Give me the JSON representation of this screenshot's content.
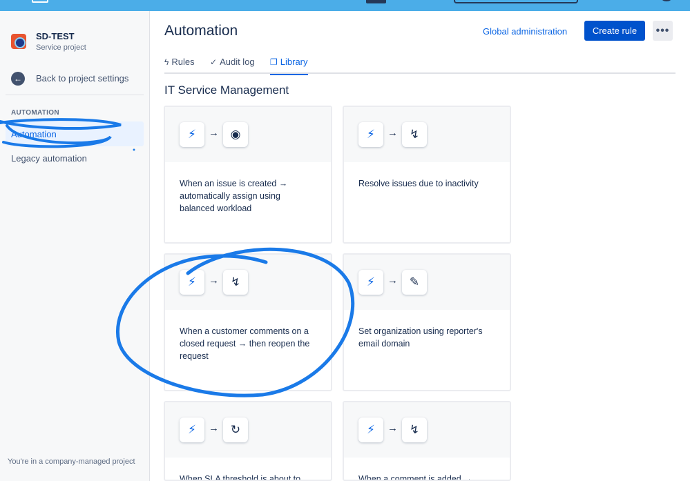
{
  "sidebar": {
    "project_name": "SD-TEST",
    "project_type": "Service project",
    "back_label": "Back to project settings",
    "section_label": "AUTOMATION",
    "nav_items": [
      "Automation",
      "Legacy automation"
    ],
    "footer": "You're in a company-managed project"
  },
  "header": {
    "title": "Automation",
    "global_admin": "Global administration",
    "create_rule": "Create rule",
    "more": "•••"
  },
  "tabs": [
    {
      "label": "Rules",
      "icon": "lightning-icon",
      "glyph": "ϟ"
    },
    {
      "label": "Audit log",
      "icon": "check-circle-icon",
      "glyph": "✓"
    },
    {
      "label": "Library",
      "icon": "library-icon",
      "glyph": "❐"
    }
  ],
  "section_title": "IT Service Management",
  "cards": [
    {
      "text": "When an issue is created → automatically assign using balanced workload",
      "trigger_icon": "lightning-icon",
      "action_icon": "user-circle-icon",
      "action_glyph": "◉"
    },
    {
      "text": "Resolve issues due to inactivity",
      "trigger_icon": "lightning-icon",
      "action_icon": "branch-icon",
      "action_glyph": "↯"
    },
    {
      "text": "When a customer comments on a closed request → then reopen the request",
      "trigger_icon": "lightning-icon",
      "action_icon": "branch-icon",
      "action_glyph": "↯"
    },
    {
      "text": "Set organization using reporter's email domain",
      "trigger_icon": "lightning-icon",
      "action_icon": "pencil-icon",
      "action_glyph": "✎"
    },
    {
      "text": "When SLA threshold is about to",
      "trigger_icon": "lightning-icon",
      "action_icon": "refresh-icon",
      "action_glyph": "↻"
    },
    {
      "text": "When a comment is added →",
      "trigger_icon": "lightning-icon",
      "action_icon": "branch-icon",
      "action_glyph": "↯"
    }
  ],
  "colors": {
    "accent": "#0C66E4",
    "primary_button": "#0052CC",
    "annotation": "#1A7AE8",
    "topbar": "#4BADE8"
  }
}
